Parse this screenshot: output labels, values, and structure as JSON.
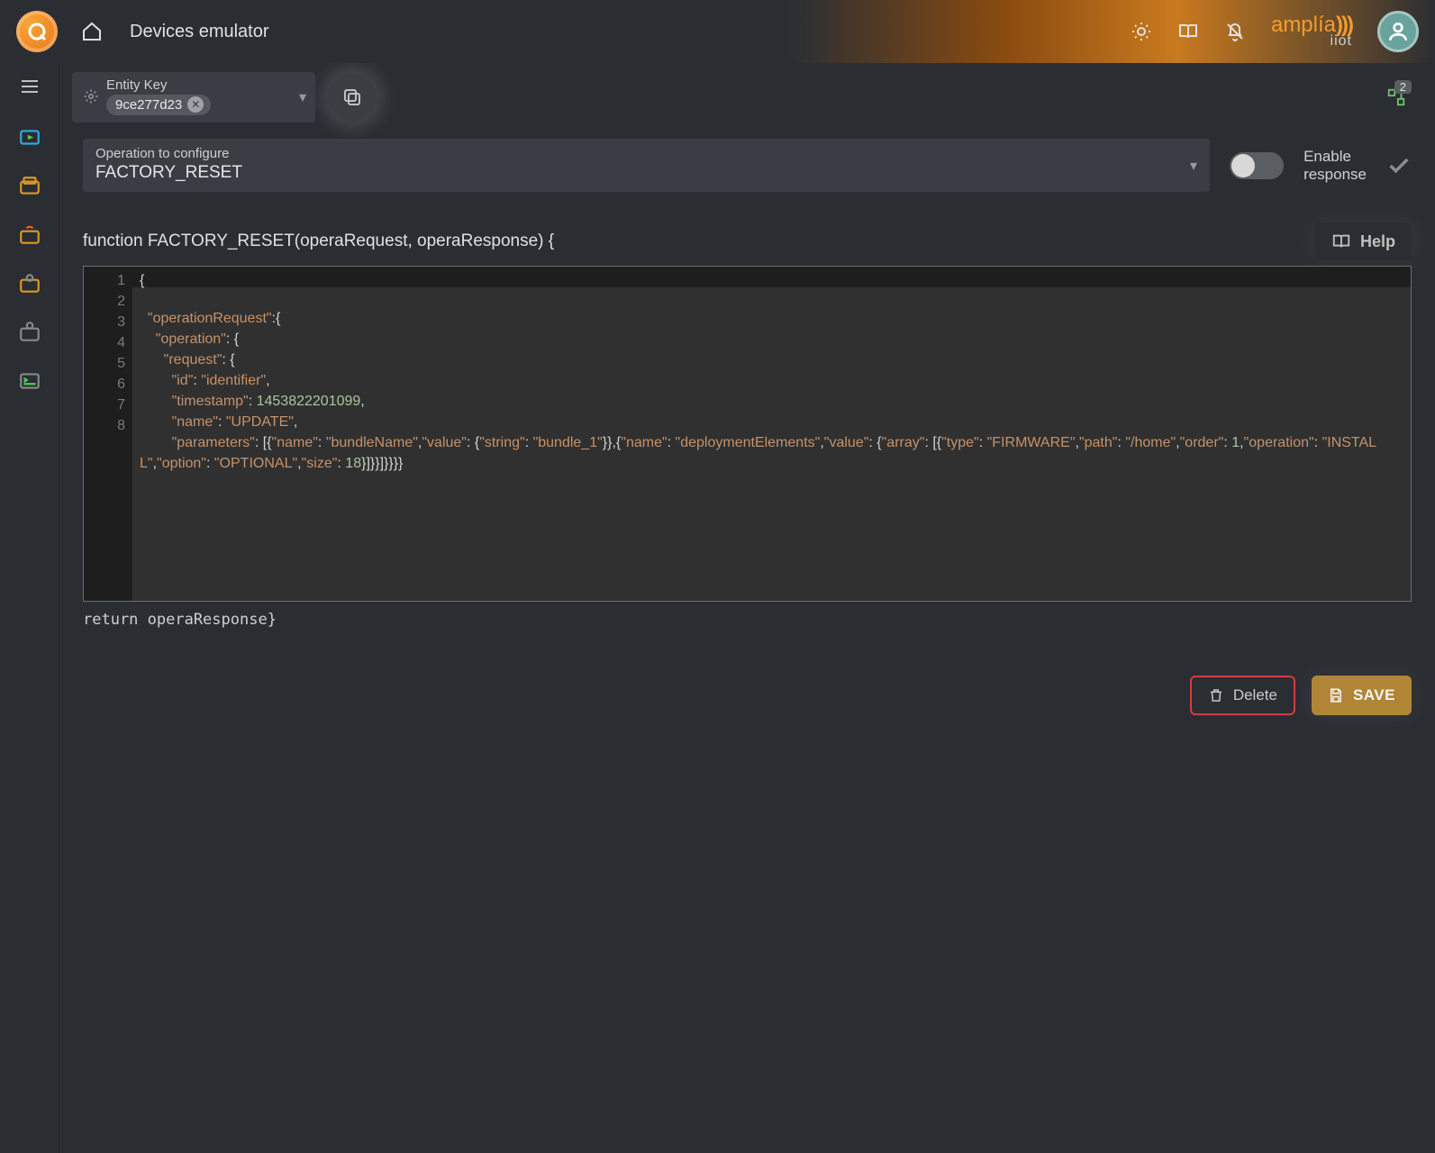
{
  "header": {
    "title": "Devices emulator",
    "brand_name": "amplía",
    "brand_waves": ")))",
    "brand_sub": "iiot"
  },
  "topbar_icons": [
    "sun-icon",
    "book-icon",
    "bell-off-icon"
  ],
  "entity": {
    "label": "Entity Key",
    "value": "9ce277d23"
  },
  "graph_badge_count": "2",
  "operation_select": {
    "label": "Operation to configure",
    "value": "FACTORY_RESET"
  },
  "toggle": {
    "enabled": false,
    "label_line1": "Enable",
    "label_line2": "response"
  },
  "help_label": "Help",
  "function_signature": "function FACTORY_RESET(operaRequest, operaResponse) {",
  "code_lines": [
    "1",
    "2",
    "3",
    "4",
    "5",
    "6",
    "7",
    "8"
  ],
  "code_tokens": {
    "l1": [
      {
        "t": "{",
        "c": "p"
      }
    ],
    "l2": [
      {
        "t": "  ",
        "c": "p"
      },
      {
        "t": "\"operationRequest\"",
        "c": "s"
      },
      {
        "t": ":{",
        "c": "p"
      }
    ],
    "l3": [
      {
        "t": "    ",
        "c": "p"
      },
      {
        "t": "\"operation\"",
        "c": "s"
      },
      {
        "t": ": {",
        "c": "p"
      }
    ],
    "l4": [
      {
        "t": "      ",
        "c": "p"
      },
      {
        "t": "\"request\"",
        "c": "s"
      },
      {
        "t": ": {",
        "c": "p"
      }
    ],
    "l5": [
      {
        "t": "        ",
        "c": "p"
      },
      {
        "t": "\"id\"",
        "c": "s"
      },
      {
        "t": ": ",
        "c": "p"
      },
      {
        "t": "\"identifier\"",
        "c": "s"
      },
      {
        "t": ",",
        "c": "p"
      }
    ],
    "l6": [
      {
        "t": "        ",
        "c": "p"
      },
      {
        "t": "\"timestamp\"",
        "c": "s"
      },
      {
        "t": ": ",
        "c": "p"
      },
      {
        "t": "1453822201099",
        "c": "n"
      },
      {
        "t": ",",
        "c": "p"
      }
    ],
    "l7": [
      {
        "t": "        ",
        "c": "p"
      },
      {
        "t": "\"name\"",
        "c": "s"
      },
      {
        "t": ": ",
        "c": "p"
      },
      {
        "t": "\"UPDATE\"",
        "c": "s"
      },
      {
        "t": ",",
        "c": "p"
      }
    ],
    "l8": [
      {
        "t": "        ",
        "c": "p"
      },
      {
        "t": "\"parameters\"",
        "c": "s"
      },
      {
        "t": ": [{",
        "c": "p"
      },
      {
        "t": "\"name\"",
        "c": "s"
      },
      {
        "t": ": ",
        "c": "p"
      },
      {
        "t": "\"bundleName\"",
        "c": "s"
      },
      {
        "t": ",",
        "c": "p"
      },
      {
        "t": "\"value\"",
        "c": "s"
      },
      {
        "t": ": {",
        "c": "p"
      },
      {
        "t": "\"string\"",
        "c": "s"
      },
      {
        "t": ": ",
        "c": "p"
      },
      {
        "t": "\"bundle_1\"",
        "c": "s"
      },
      {
        "t": "}},{",
        "c": "p"
      },
      {
        "t": "\"name\"",
        "c": "s"
      },
      {
        "t": ": ",
        "c": "p"
      },
      {
        "t": "\"deploymentElements\"",
        "c": "s"
      },
      {
        "t": ",",
        "c": "p"
      },
      {
        "t": "\"value\"",
        "c": "s"
      },
      {
        "t": ": {",
        "c": "p"
      },
      {
        "t": "\"array\"",
        "c": "s"
      },
      {
        "t": ": [{",
        "c": "p"
      },
      {
        "t": "\"type\"",
        "c": "s"
      },
      {
        "t": ": ",
        "c": "p"
      },
      {
        "t": "\"FIRMWARE\"",
        "c": "s"
      },
      {
        "t": ",",
        "c": "p"
      },
      {
        "t": "\"path\"",
        "c": "s"
      },
      {
        "t": ": ",
        "c": "p"
      },
      {
        "t": "\"/home\"",
        "c": "s"
      },
      {
        "t": ",",
        "c": "p"
      },
      {
        "t": "\"order\"",
        "c": "s"
      },
      {
        "t": ": ",
        "c": "p"
      },
      {
        "t": "1",
        "c": "n"
      },
      {
        "t": ",",
        "c": "p"
      },
      {
        "t": "\"operation\"",
        "c": "s"
      },
      {
        "t": ": ",
        "c": "p"
      },
      {
        "t": "\"INSTALL\"",
        "c": "s"
      },
      {
        "t": ",",
        "c": "p"
      },
      {
        "t": "\"option\"",
        "c": "s"
      },
      {
        "t": ": ",
        "c": "p"
      },
      {
        "t": "\"OPTIONAL\"",
        "c": "s"
      },
      {
        "t": ",",
        "c": "p"
      },
      {
        "t": "\"size\"",
        "c": "s"
      },
      {
        "t": ": ",
        "c": "p"
      },
      {
        "t": "18",
        "c": "n"
      },
      {
        "t": "}]}}]}}}}",
        "c": "p"
      }
    ]
  },
  "return_line": "return operaResponse}",
  "buttons": {
    "delete": "Delete",
    "save": "SAVE"
  },
  "sidebar_items": [
    "menu",
    "emulator",
    "device",
    "alarm",
    "config",
    "gear",
    "terminal"
  ]
}
